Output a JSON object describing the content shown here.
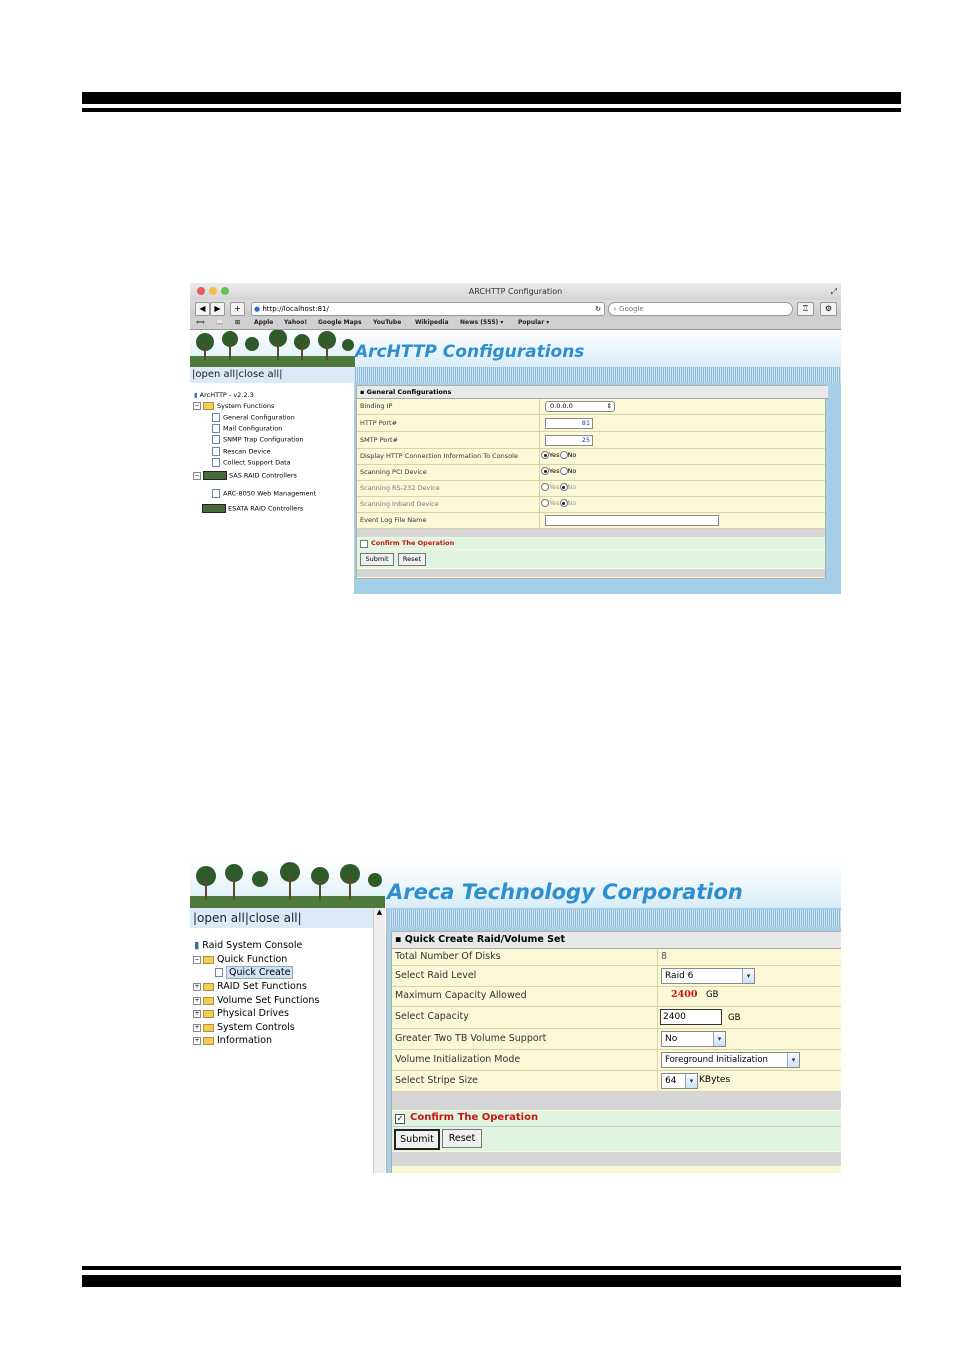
{
  "shot1": {
    "window_title": "ARCHTTP Configuration",
    "url": "http://localhost:81/",
    "search_placeholder": "Google",
    "bookmarks": [
      "Apple",
      "Yahoo!",
      "Google Maps",
      "YouTube",
      "Wikipedia",
      "News (555) ▾",
      "Popular ▾"
    ],
    "banner_title": "ArcHTTP Configurations",
    "open_close": "|open all|close all|",
    "tree": {
      "root": "ArcHTTP - v2.2.3",
      "system_functions": "System Functions",
      "children": [
        "General Configuration",
        "Mail Configuration",
        "SNMP Trap Configuration",
        "Rescan Device",
        "Collect Support Data"
      ],
      "sas": "SAS RAID Controllers",
      "sas_child": "ARC-8050 Web Management",
      "esata": "ESATA RAID Controllers"
    },
    "form": {
      "section_title": "General Configurations",
      "binding_ip_label": "Binding IP",
      "binding_ip_value": "0.0.0.0",
      "http_port_label": "HTTP Port#",
      "http_port_value": "81",
      "smtp_port_label": "SMTP Port#",
      "smtp_port_value": "25",
      "display_http_label": "Display HTTP Connection Information To Console",
      "scan_pci_label": "Scanning PCI Device",
      "scan_rs232_label": "Scanning RS-232 Device",
      "scan_inband_label": "Scanning Inband Device",
      "event_log_label": "Event Log File Name",
      "yes": "Yes",
      "no": "No",
      "confirm_label": "Confirm The Operation",
      "submit": "Submit",
      "reset": "Reset"
    }
  },
  "shot2": {
    "banner_title": "Areca Technology Corporation",
    "open_close": "|open all|close all|",
    "tree": {
      "root": "Raid System Console",
      "quick_function": "Quick Function",
      "quick_create": "Quick Create",
      "items": [
        "RAID Set Functions",
        "Volume Set Functions",
        "Physical Drives",
        "System Controls",
        "Information"
      ]
    },
    "form": {
      "section_title": "Quick Create Raid/Volume Set",
      "total_disks_label": "Total Number Of Disks",
      "total_disks_value": "8",
      "raid_level_label": "Select Raid Level",
      "raid_level_value": "Raid 6",
      "max_capacity_label": "Maximum Capacity Allowed",
      "max_capacity_value": "2400",
      "gb": "GB",
      "select_capacity_label": "Select Capacity",
      "select_capacity_value": "2400",
      "tb_support_label": "Greater Two TB Volume Support",
      "tb_support_value": "No",
      "init_mode_label": "Volume Initialization Mode",
      "init_mode_value": "Foreground Initialization",
      "stripe_label": "Select Stripe Size",
      "stripe_value": "64",
      "kbytes": "KBytes",
      "confirm_label": "Confirm The Operation",
      "submit": "Submit",
      "reset": "Reset"
    }
  },
  "colors": {
    "banner_blue": "#2e8fd0",
    "confirm_red": "#cc1111",
    "form_bg": "#fbf8d8",
    "confirm_bg": "#dff5df"
  }
}
